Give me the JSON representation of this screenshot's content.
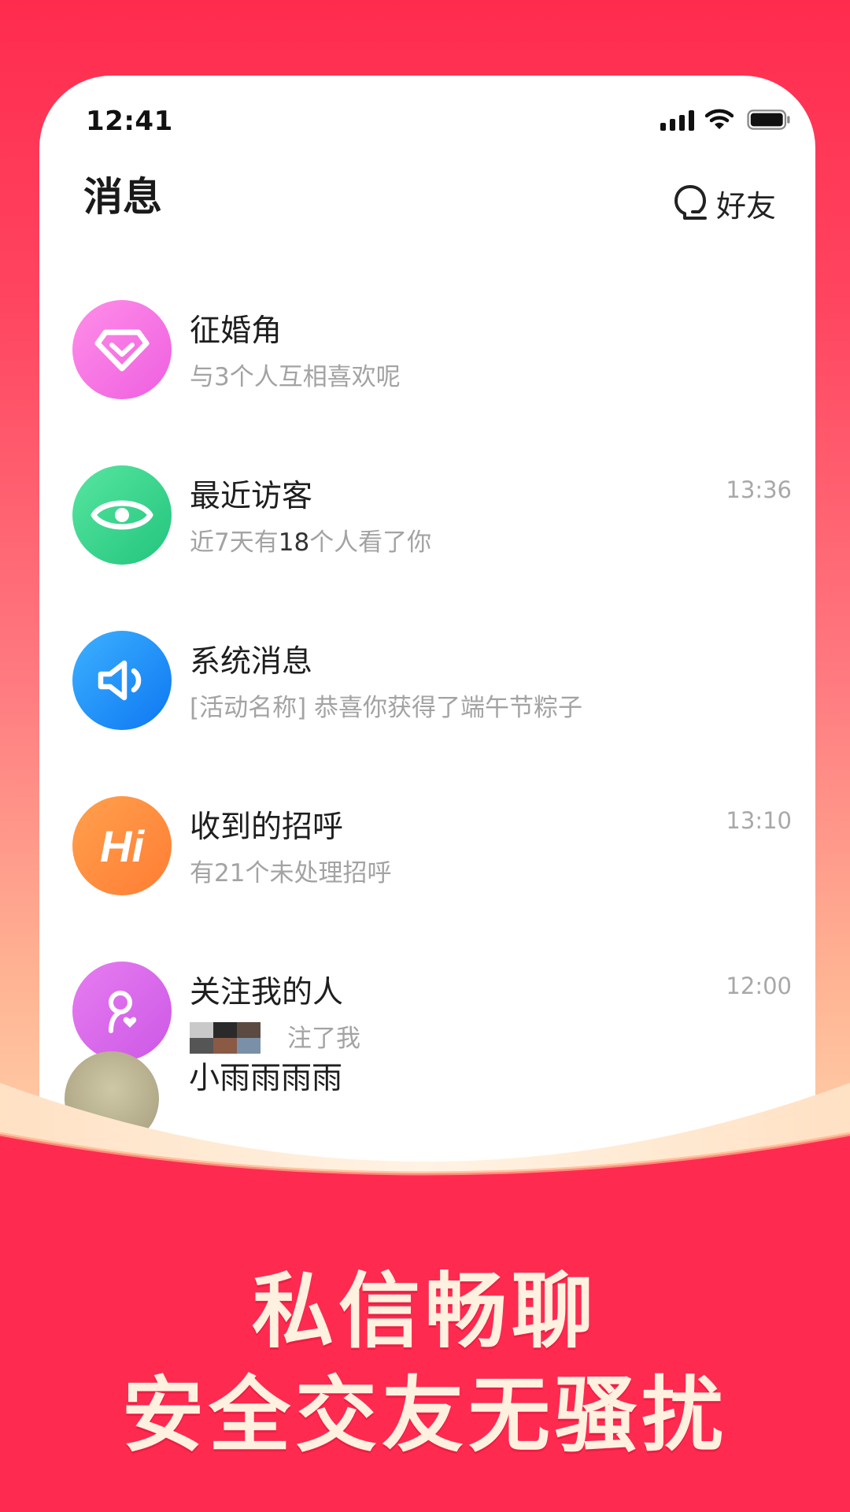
{
  "status_bar": {
    "time": "12:41"
  },
  "header": {
    "title": "消息",
    "friends_label": "好友"
  },
  "messages": [
    {
      "title": "征婚角",
      "subtitle": "与3个人互相喜欢呢",
      "time": "",
      "icon": "diamond-icon",
      "color": "#f070dc"
    },
    {
      "title": "最近访客",
      "subtitle_pre": "近7天有",
      "subtitle_num": "18",
      "subtitle_post": "个人看了你",
      "time": "13:36",
      "icon": "eye-icon",
      "color": "#2fd28a"
    },
    {
      "title": "系统消息",
      "subtitle": "[活动名称] 恭喜你获得了端午节粽子",
      "time": "",
      "icon": "speaker-icon",
      "color": "#1a8cff"
    },
    {
      "title": "收到的招呼",
      "subtitle": "有21个未处理招呼",
      "time": "13:10",
      "icon": "hi-icon",
      "icon_text": "Hi",
      "color": "#ff8a3d"
    },
    {
      "title": "关注我的人",
      "subtitle": "注了我",
      "time": "12:00",
      "icon": "follower-heart-icon",
      "color": "#d866e8"
    }
  ],
  "partial_item": {
    "title": "小雨雨雨雨"
  },
  "banner": {
    "line1": "私信畅聊",
    "line2": "安全交友无骚扰"
  },
  "colors": {
    "brand_red": "#ff2a4f",
    "cream": "#fff1e0"
  }
}
